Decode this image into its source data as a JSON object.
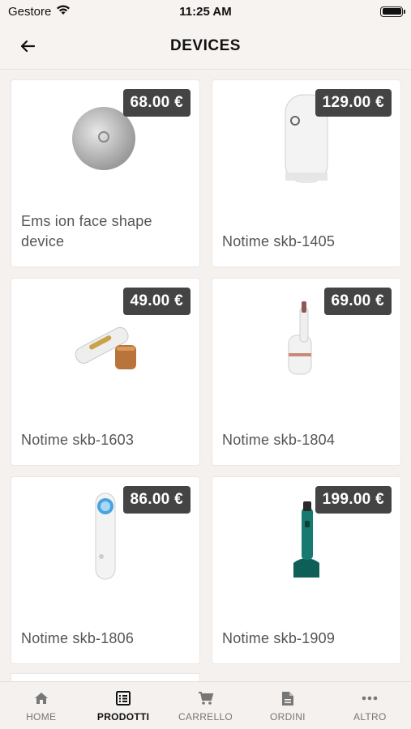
{
  "status": {
    "carrier": "Gestore",
    "time": "11:25 AM"
  },
  "nav": {
    "title": "DEVICES"
  },
  "products": [
    {
      "name": "Ems ion face shape device",
      "price": "68.00 €"
    },
    {
      "name": "Notime skb-1405",
      "price": "129.00 €"
    },
    {
      "name": "Notime skb-1603",
      "price": "49.00 €"
    },
    {
      "name": "Notime skb-1804",
      "price": "69.00 €"
    },
    {
      "name": "Notime skb-1806",
      "price": "86.00 €"
    },
    {
      "name": "Notime skb-1909",
      "price": "199.00 €"
    }
  ],
  "tabs": [
    {
      "label": "HOME",
      "icon": "home-icon"
    },
    {
      "label": "PRODOTTI",
      "icon": "list-icon",
      "active": true
    },
    {
      "label": "CARRELLO",
      "icon": "cart-icon"
    },
    {
      "label": "ORDINI",
      "icon": "document-icon"
    },
    {
      "label": "ALTRO",
      "icon": "more-icon"
    }
  ],
  "colors": {
    "price_badge": "#444444",
    "background": "#f4f1ef",
    "card": "#ffffff"
  }
}
